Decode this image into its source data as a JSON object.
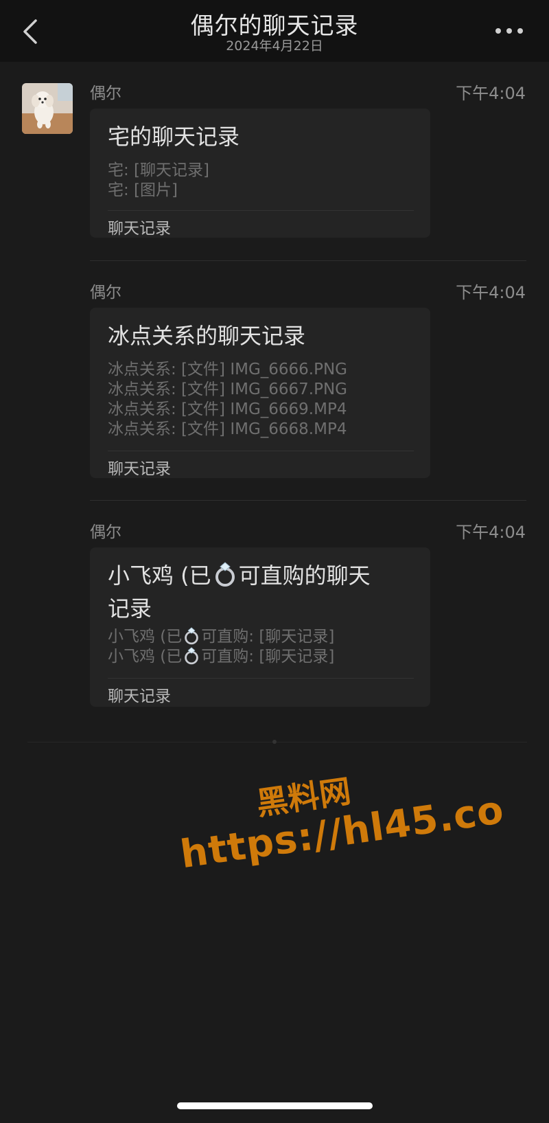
{
  "header": {
    "title": "偶尔的聊天记录",
    "date": "2024年4月22日"
  },
  "messages": [
    {
      "sender": "偶尔",
      "time": "下午4:04",
      "card": {
        "title": "宅的聊天记录",
        "lines": [
          "宅: [聊天记录]",
          "宅: [图片]"
        ],
        "footer": "聊天记录"
      }
    },
    {
      "sender": "偶尔",
      "time": "下午4:04",
      "card": {
        "title": "冰点关系的聊天记录",
        "lines": [
          "冰点关系: [文件] IMG_6666.PNG",
          "冰点关系: [文件] IMG_6667.PNG",
          "冰点关系: [文件] IMG_6669.MP4",
          "冰点关系: [文件] IMG_6668.MP4"
        ],
        "footer": "聊天记录"
      }
    },
    {
      "sender": "偶尔",
      "time": "下午4:04",
      "card": {
        "title_part1": "小飞鸡 (已",
        "title_part2": "可直购的聊天",
        "title_line2": "记录",
        "lines": [
          {
            "before": "小飞鸡 (已",
            "after": "可直购: [聊天记录]"
          },
          {
            "before": "小飞鸡 (已",
            "after": "可直购: [聊天记录]"
          }
        ],
        "footer": "聊天记录"
      }
    }
  ],
  "watermark": {
    "line1": "黑料网",
    "line2": "https://hl45.co"
  },
  "icons": {
    "back": "chevron-left-icon",
    "more": "more-dots-icon",
    "ring": "ring-emoji-icon"
  },
  "colors": {
    "background": "#1b1b1b",
    "header": "#121212",
    "card": "#242424",
    "watermark": "#cf7a0a"
  }
}
